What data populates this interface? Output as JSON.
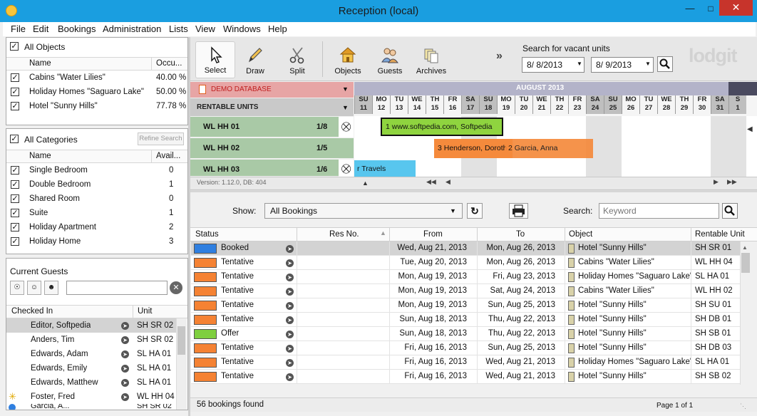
{
  "window": {
    "title": "Reception (local)"
  },
  "menu": [
    "File",
    "Edit",
    "Bookings",
    "Administration",
    "Lists",
    "View",
    "Windows",
    "Help"
  ],
  "objects": {
    "header_label": "All Objects",
    "col_name": "Name",
    "col_occ": "Occu...",
    "items": [
      {
        "name": "Cabins \"Water Lilies\"",
        "occ": "40.00 %"
      },
      {
        "name": "Holiday Homes \"Saguaro Lake\"",
        "occ": "50.00 %"
      },
      {
        "name": "Hotel \"Sunny Hills\"",
        "occ": "77.78 %"
      }
    ]
  },
  "categories": {
    "header_label": "All Categories",
    "refine_label": "Refine Search",
    "col_name": "Name",
    "col_avail": "Avail...",
    "items": [
      {
        "name": "Single Bedroom",
        "avail": "0"
      },
      {
        "name": "Double Bedroom",
        "avail": "1"
      },
      {
        "name": "Shared Room",
        "avail": "0"
      },
      {
        "name": "Suite",
        "avail": "1"
      },
      {
        "name": "Holiday Apartment",
        "avail": "2"
      },
      {
        "name": "Holiday Home",
        "avail": "3"
      }
    ]
  },
  "guests": {
    "title": "Current Guests",
    "col_checked": "Checked In",
    "col_unit": "Unit",
    "items": [
      {
        "name": "Editor, Softpedia",
        "unit": "SH SR 02"
      },
      {
        "name": "Anders, Tim",
        "unit": "SH SR 02"
      },
      {
        "name": "Edwards, Adam",
        "unit": "SL HA 01"
      },
      {
        "name": "Edwards, Emily",
        "unit": "SL HA 01"
      },
      {
        "name": "Edwards, Matthew",
        "unit": "SL HA 01"
      },
      {
        "name": "Foster, Fred",
        "unit": "WL HH 04"
      },
      {
        "name": "Garcia, A...",
        "unit": "SH SR 02"
      }
    ]
  },
  "toolbar": {
    "select": "Select",
    "draw": "Draw",
    "split": "Split",
    "objects": "Objects",
    "guests": "Guests",
    "archives": "Archives",
    "search_label": "Search for vacant units",
    "date_from": "8/ 8/2013",
    "date_to": "8/ 9/2013",
    "logo": "lodgit"
  },
  "planner": {
    "database": "DEMO DATABASE",
    "rentable": "RENTABLE UNITS",
    "month": "AUGUST 2013",
    "days": [
      {
        "d": "SU",
        "n": "11"
      },
      {
        "d": "MO",
        "n": "12"
      },
      {
        "d": "TU",
        "n": "13"
      },
      {
        "d": "WE",
        "n": "14"
      },
      {
        "d": "TH",
        "n": "15"
      },
      {
        "d": "FR",
        "n": "16"
      },
      {
        "d": "SA",
        "n": "17"
      },
      {
        "d": "SU",
        "n": "18"
      },
      {
        "d": "MO",
        "n": "19"
      },
      {
        "d": "TU",
        "n": "20"
      },
      {
        "d": "WE",
        "n": "21"
      },
      {
        "d": "TH",
        "n": "22"
      },
      {
        "d": "FR",
        "n": "23"
      },
      {
        "d": "SA",
        "n": "24"
      },
      {
        "d": "SU",
        "n": "25"
      },
      {
        "d": "MO",
        "n": "26"
      },
      {
        "d": "TU",
        "n": "27"
      },
      {
        "d": "WE",
        "n": "28"
      },
      {
        "d": "TH",
        "n": "29"
      },
      {
        "d": "FR",
        "n": "30"
      },
      {
        "d": "SA",
        "n": "31"
      },
      {
        "d": "S",
        "n": "1"
      }
    ],
    "units": [
      {
        "name": "WL HH 01",
        "ratio": "1/8"
      },
      {
        "name": "WL HH 02",
        "ratio": "1/5"
      },
      {
        "name": "WL HH 03",
        "ratio": "1/6"
      }
    ],
    "bars": [
      "1 www.softpedia.com, Softpedia",
      "3 Henderson, Doroth",
      "2 Garcia, Anna",
      "r Travels"
    ],
    "version": "Version: 1.12.0, DB: 404"
  },
  "bookings": {
    "show_label": "Show:",
    "show_value": "All Bookings",
    "search_label": "Search:",
    "search_placeholder": "Keyword",
    "columns": [
      "Status",
      "Res No.",
      "From",
      "To",
      "Object",
      "Rentable Unit"
    ],
    "rows": [
      {
        "status": "Booked",
        "color": "#2f7fe0",
        "from": "Wed, Aug 21, 2013",
        "to": "Mon, Aug 26, 2013",
        "object": "Hotel \"Sunny Hills\"",
        "unit": "SH SR 01"
      },
      {
        "status": "Tentative",
        "color": "#f58233",
        "from": "Tue, Aug 20, 2013",
        "to": "Mon, Aug 26, 2013",
        "object": "Cabins \"Water Lilies\"",
        "unit": "WL HH 04"
      },
      {
        "status": "Tentative",
        "color": "#f58233",
        "from": "Mon, Aug 19, 2013",
        "to": "Fri, Aug 23, 2013",
        "object": "Holiday Homes \"Saguaro Lake\"",
        "unit": "SL HA 01"
      },
      {
        "status": "Tentative",
        "color": "#f58233",
        "from": "Mon, Aug 19, 2013",
        "to": "Sat, Aug 24, 2013",
        "object": "Cabins \"Water Lilies\"",
        "unit": "WL HH 02"
      },
      {
        "status": "Tentative",
        "color": "#f58233",
        "from": "Mon, Aug 19, 2013",
        "to": "Sun, Aug 25, 2013",
        "object": "Hotel \"Sunny Hills\"",
        "unit": "SH SU 01"
      },
      {
        "status": "Tentative",
        "color": "#f58233",
        "from": "Sun, Aug 18, 2013",
        "to": "Thu, Aug 22, 2013",
        "object": "Hotel \"Sunny Hills\"",
        "unit": "SH DB 01"
      },
      {
        "status": "Offer",
        "color": "#7fcf3f",
        "from": "Sun, Aug 18, 2013",
        "to": "Thu, Aug 22, 2013",
        "object": "Hotel \"Sunny Hills\"",
        "unit": "SH SB 01"
      },
      {
        "status": "Tentative",
        "color": "#f58233",
        "from": "Fri, Aug 16, 2013",
        "to": "Sun, Aug 25, 2013",
        "object": "Hotel \"Sunny Hills\"",
        "unit": "SH DB 03"
      },
      {
        "status": "Tentative",
        "color": "#f58233",
        "from": "Fri, Aug 16, 2013",
        "to": "Wed, Aug 21, 2013",
        "object": "Holiday Homes \"Saguaro Lake\"",
        "unit": "SL HA 01"
      },
      {
        "status": "Tentative",
        "color": "#f58233",
        "from": "Fri, Aug 16, 2013",
        "to": "Wed, Aug 21, 2013",
        "object": "Hotel \"Sunny Hills\"",
        "unit": "SH SB 02"
      }
    ],
    "found": "56 bookings found",
    "page": "Page 1 of 1"
  }
}
